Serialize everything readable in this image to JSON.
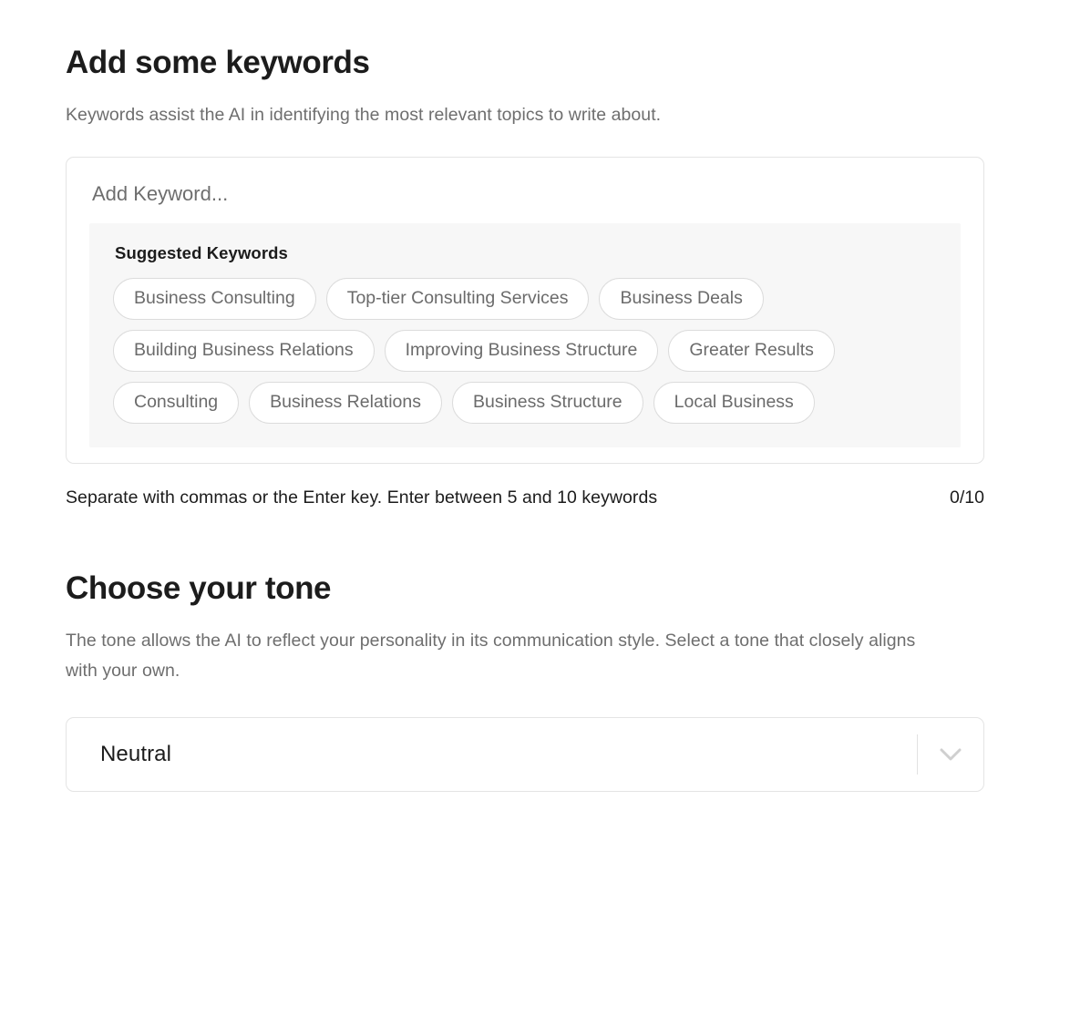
{
  "keywords_section": {
    "title": "Add some keywords",
    "subtitle": "Keywords assist the AI in identifying the most relevant topics to write about.",
    "input": {
      "value": "",
      "placeholder": "Add Keyword..."
    },
    "suggested": {
      "heading": "Suggested Keywords",
      "chips": [
        "Business Consulting",
        "Top-tier Consulting Services",
        "Business Deals",
        "Building Business Relations",
        "Improving Business Structure",
        "Greater Results",
        "Consulting",
        "Business Relations",
        "Business Structure",
        "Local Business"
      ]
    },
    "helper_text": "Separate with commas or the Enter key. Enter between 5 and 10 keywords",
    "counter": "0/10"
  },
  "tone_section": {
    "title": "Choose your tone",
    "subtitle": "The tone allows the AI to reflect your personality in its communication style. Select a tone that closely aligns with your own.",
    "select": {
      "value": "Neutral",
      "icon": "chevron-down-icon"
    }
  },
  "colors": {
    "text_primary": "#1c1c1c",
    "text_secondary": "#6e6e6e",
    "chip_text": "#6b6b6b",
    "border": "#e4e4e4",
    "chip_border": "#dcdcdc",
    "panel_bg": "#f7f7f7",
    "page_bg": "#ffffff"
  }
}
